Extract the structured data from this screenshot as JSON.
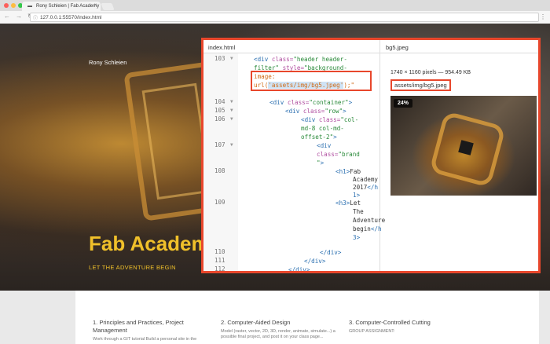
{
  "browser": {
    "tab_title": "Rony Schleien | Fab Academy",
    "url": "127.0.0.1:55570/index.html"
  },
  "hero": {
    "brand": "Rony Schleien",
    "title": "Fab Academy",
    "subtitle": "LET THE ADVENTURE BEGIN"
  },
  "columns": [
    {
      "title": "1. Principles and Practices, Project Management",
      "text": "Work through a GIT tutorial Build a personal site in the"
    },
    {
      "title": "2. Computer-Aided Design",
      "text": "Model (raster, vector, 2D, 3D, render, animate, simulate...) a possible final project, and post it on your class page..."
    },
    {
      "title": "3. Computer-Controlled Cutting",
      "text": "GROUP ASSIGNMENT:"
    }
  ],
  "overlay": {
    "file_tab": "index.html",
    "image_tab": "bg5.jpeg",
    "image_meta": "1740 × 1160 pixels — 954.49 KB",
    "image_path": "assets/img/bg5.jpeg",
    "zoom": "24%",
    "line_numbers": [
      "103",
      "104",
      "105",
      "106",
      "107",
      "108",
      "109",
      "110",
      "111",
      "112"
    ],
    "code": {
      "l103a_tag": "<div",
      "l103a_attr": " class=",
      "l103a_str": "\"header header-",
      "l103b_str": "filter\"",
      "l103b_attr": " style=",
      "l103b_str2": "\"background-",
      "l103c_or": "image:",
      "l103d_or": "url(",
      "l103d_hl": "'assets/img/bg5.jpeg'",
      "l103d_end": ");\"",
      "l104_tag": "<div",
      "l104_attr": " class=",
      "l104_str": "\"container\"",
      "l104_end": ">",
      "l105_tag": "<div",
      "l105_attr": " class=",
      "l105_str": "\"row\"",
      "l105_end": ">",
      "l106_tag": "<div",
      "l106_attr": " class=",
      "l106_str": "\"col-",
      "l106b_str": "md-8 col-md-",
      "l106c_str": "offset-2\"",
      "l106c_end": ">",
      "l107a_tag": "<div",
      "l107b_attr": "class=",
      "l107b_str": "\"brand",
      "l107c_str": "\"",
      "l107c_end": ">",
      "l108a_tag": "<h1>",
      "l108a_txt": "Fab",
      "l108b_txt": "Academy",
      "l108c_txt": "2017",
      "l108c_tag": "</h",
      "l108d_tag": "1>",
      "l109a_tag": "<h3>",
      "l109a_txt": "Let",
      "l109b_txt": "The",
      "l109c_txt": "Adventure",
      "l109d_txt": "begin",
      "l109d_tag": "</h",
      "l109e_tag": "3>",
      "l110_tag": "</div>",
      "l111_tag": "</div>",
      "l112_tag": "</div>"
    }
  }
}
